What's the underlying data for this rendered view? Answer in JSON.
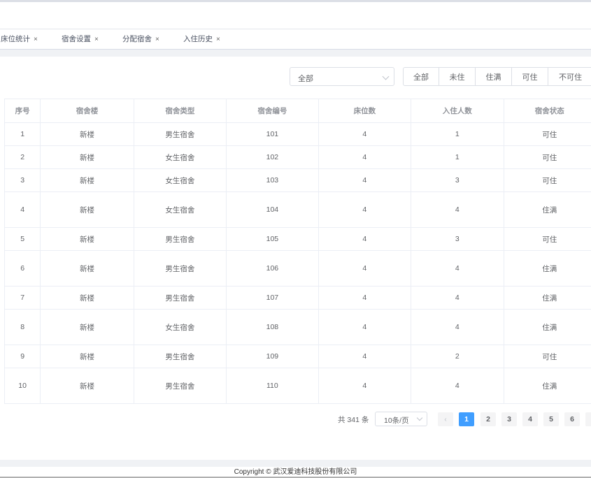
{
  "tags": [
    {
      "label": "床位统计",
      "close": "×"
    },
    {
      "label": "宿舍设置",
      "close": "×"
    },
    {
      "label": "分配宿舍",
      "close": "×"
    },
    {
      "label": "入住历史",
      "close": "×"
    }
  ],
  "filter": {
    "select_value": "全部",
    "buttons": [
      "全部",
      "未住",
      "住满",
      "可住",
      "不可住"
    ]
  },
  "table": {
    "headers": [
      "序号",
      "宿舍楼",
      "宿舍类型",
      "宿舍编号",
      "床位数",
      "入住人数",
      "宿舍状态"
    ],
    "rows": [
      [
        "1",
        "新楼",
        "男生宿舍",
        "101",
        "4",
        "1",
        "可住"
      ],
      [
        "2",
        "新楼",
        "女生宿舍",
        "102",
        "4",
        "1",
        "可住"
      ],
      [
        "3",
        "新楼",
        "女生宿舍",
        "103",
        "4",
        "3",
        "可住"
      ],
      [
        "4",
        "新楼",
        "女生宿舍",
        "104",
        "4",
        "4",
        "住满"
      ],
      [
        "5",
        "新楼",
        "男生宿舍",
        "105",
        "4",
        "3",
        "可住"
      ],
      [
        "6",
        "新楼",
        "男生宿舍",
        "106",
        "4",
        "4",
        "住满"
      ],
      [
        "7",
        "新楼",
        "男生宿舍",
        "107",
        "4",
        "4",
        "住满"
      ],
      [
        "8",
        "新楼",
        "女生宿舍",
        "108",
        "4",
        "4",
        "住满"
      ],
      [
        "9",
        "新楼",
        "男生宿舍",
        "109",
        "4",
        "2",
        "可住"
      ],
      [
        "10",
        "新楼",
        "男生宿舍",
        "110",
        "4",
        "4",
        "住满"
      ]
    ]
  },
  "pagination": {
    "total": "共 341 条",
    "page_size": "10条/页",
    "prev": "‹",
    "pages": [
      "1",
      "2",
      "3",
      "4",
      "5",
      "6"
    ],
    "current": "1"
  },
  "footer": {
    "copyright": "Copyright © 武汉爱迪科技股份有限公司"
  },
  "colors": {
    "primary": "#409eff",
    "border": "#ebeef5",
    "background_band": "#f0f2f5"
  }
}
